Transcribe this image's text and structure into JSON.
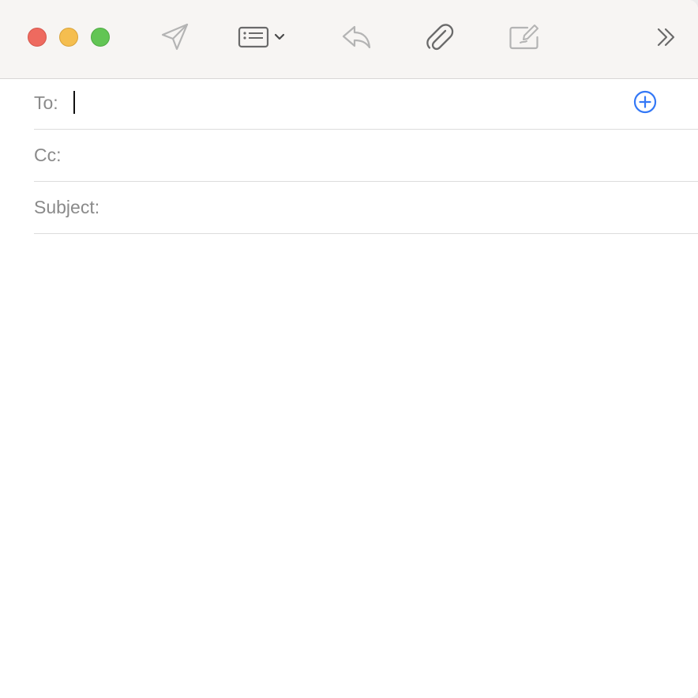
{
  "window": {
    "controls": [
      "close",
      "minimize",
      "maximize"
    ]
  },
  "toolbar": {
    "buttons": [
      {
        "name": "send",
        "icon": "paper-plane-icon",
        "enabled": false
      },
      {
        "name": "header-fields",
        "icon": "header-fields-icon",
        "enabled": true
      },
      {
        "name": "reply",
        "icon": "reply-arrow-icon",
        "enabled": false
      },
      {
        "name": "attach",
        "icon": "paperclip-icon",
        "enabled": true
      },
      {
        "name": "markup",
        "icon": "markup-compose-icon",
        "enabled": false
      },
      {
        "name": "more",
        "icon": "double-chevron-right-icon",
        "enabled": true
      }
    ]
  },
  "compose": {
    "to_label": "To:",
    "to_value": "",
    "cc_label": "Cc:",
    "cc_value": "",
    "subject_label": "Subject:",
    "subject_value": "",
    "body": ""
  },
  "colors": {
    "close": "#ee6a5f",
    "minimize": "#f5be4f",
    "maximize": "#62c554",
    "accent": "#3478f6",
    "disabled_icon": "#b4b4b4",
    "enabled_icon": "#6a6a6a"
  }
}
